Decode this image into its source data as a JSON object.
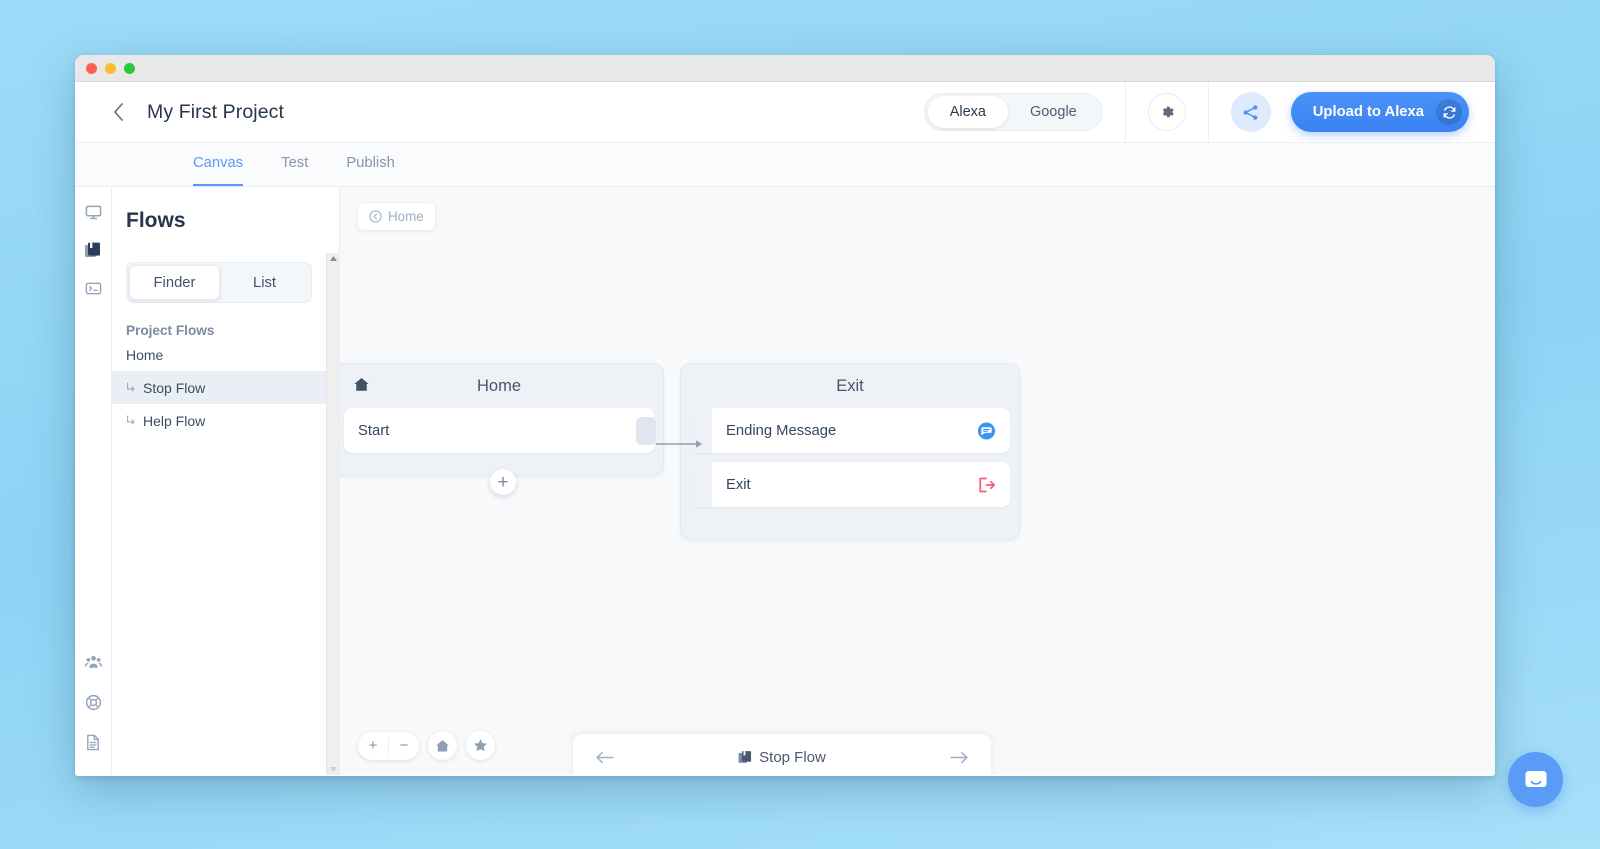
{
  "window": {
    "traffic_lights": [
      "close",
      "minimize",
      "maximize"
    ]
  },
  "header": {
    "back_icon": "chevron-left-icon",
    "title": "My First Project",
    "platform_toggle": {
      "options": [
        "Alexa",
        "Google"
      ],
      "selected": "Alexa"
    },
    "gear_icon": "gear-icon",
    "share_icon": "share-icon",
    "upload_label": "Upload to Alexa",
    "upload_icon": "refresh-icon",
    "accent_blue": "#3a82f2"
  },
  "tabs": [
    {
      "label": "Canvas",
      "active": true
    },
    {
      "label": "Test",
      "active": false
    },
    {
      "label": "Publish",
      "active": false
    }
  ],
  "rail": {
    "top_items": [
      {
        "name": "canvas-monitor-icon",
        "active": false
      },
      {
        "name": "library-books-icon",
        "active": true
      },
      {
        "name": "code-terminal-icon",
        "active": false
      }
    ],
    "bottom_items": [
      {
        "name": "team-users-icon"
      },
      {
        "name": "lifebuoy-help-icon"
      },
      {
        "name": "document-icon"
      }
    ]
  },
  "flows_panel": {
    "title": "Flows",
    "view_toggle": {
      "options": [
        "Finder",
        "List"
      ],
      "selected": "Finder"
    },
    "group_label": "Project Flows",
    "items": [
      {
        "label": "Home",
        "nested": false,
        "selected": false
      },
      {
        "label": "Stop Flow",
        "nested": true,
        "selected": true
      },
      {
        "label": "Help Flow",
        "nested": true,
        "selected": false
      }
    ],
    "scrollbar": {
      "up_arrow": "▲",
      "down_arrow": "▼"
    }
  },
  "canvas": {
    "breadcrumb": {
      "icon": "history-back-icon",
      "label": "Home"
    },
    "nodes": [
      {
        "title": "Home",
        "icon": "home-icon",
        "steps": [
          {
            "label": "Start",
            "right_icon": "",
            "has_out_port": true,
            "has_in_port": false
          }
        ],
        "add_button": "+"
      },
      {
        "title": "Exit",
        "icon": "",
        "steps": [
          {
            "label": "Ending Message",
            "right_icon": "speech-bubble-icon",
            "icon_color": "#3d94f5",
            "has_in_port": true
          },
          {
            "label": "Exit",
            "right_icon": "exit-arrow-icon",
            "icon_color": "#f9577e",
            "has_in_port": true
          }
        ]
      }
    ],
    "zoom_controls": {
      "zoom_in": "+",
      "zoom_out": "−",
      "home_icon": "home-icon",
      "star_icon": "star-icon"
    },
    "flow_nav": {
      "prev_icon": "arrow-left-icon",
      "next_icon": "arrow-right-icon",
      "flow_icon": "flow-copy-icon",
      "flow_name": "Stop Flow"
    }
  },
  "intercom": {
    "icon": "intercom-chat-icon",
    "color": "#5b9bf8"
  }
}
